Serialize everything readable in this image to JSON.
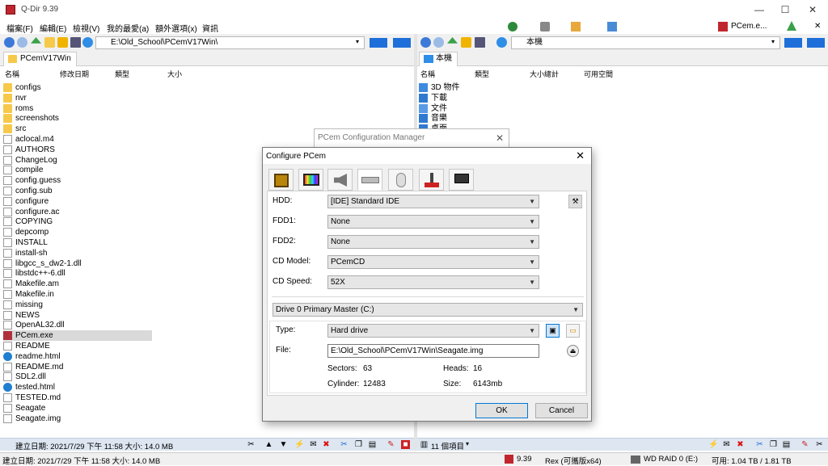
{
  "window": {
    "title": "Q-Dir 9.39",
    "minimize": "—",
    "maximize": "☐",
    "close": "✕"
  },
  "menu": [
    "檔案(F)",
    "編輯(E)",
    "檢視(V)",
    "我的最愛(a)",
    "額外選項(x)",
    "資訊"
  ],
  "menu_right_label": "PCem.e...",
  "left_pane": {
    "address": "E:\\Old_School\\PCemV17Win\\",
    "tab": "PCemV17Win",
    "columns": [
      "名稱",
      "修改日期",
      "類型",
      "大小"
    ],
    "files": [
      {
        "name": "configs",
        "kind": "folder"
      },
      {
        "name": "nvr",
        "kind": "folder"
      },
      {
        "name": "roms",
        "kind": "folder"
      },
      {
        "name": "screenshots",
        "kind": "folder"
      },
      {
        "name": "src",
        "kind": "folder"
      },
      {
        "name": "aclocal.m4",
        "kind": "file"
      },
      {
        "name": "AUTHORS",
        "kind": "file"
      },
      {
        "name": "ChangeLog",
        "kind": "file"
      },
      {
        "name": "compile",
        "kind": "file"
      },
      {
        "name": "config.guess",
        "kind": "file"
      },
      {
        "name": "config.sub",
        "kind": "file"
      },
      {
        "name": "configure",
        "kind": "file"
      },
      {
        "name": "configure.ac",
        "kind": "file"
      },
      {
        "name": "COPYING",
        "kind": "file"
      },
      {
        "name": "depcomp",
        "kind": "file"
      },
      {
        "name": "INSTALL",
        "kind": "file"
      },
      {
        "name": "install-sh",
        "kind": "file"
      },
      {
        "name": "libgcc_s_dw2-1.dll",
        "kind": "file"
      },
      {
        "name": "libstdc++-6.dll",
        "kind": "file"
      },
      {
        "name": "Makefile.am",
        "kind": "file"
      },
      {
        "name": "Makefile.in",
        "kind": "file"
      },
      {
        "name": "missing",
        "kind": "file"
      },
      {
        "name": "NEWS",
        "kind": "file"
      },
      {
        "name": "OpenAL32.dll",
        "kind": "file"
      },
      {
        "name": "PCem.exe",
        "kind": "exe",
        "selected": true
      },
      {
        "name": "README",
        "kind": "file"
      },
      {
        "name": "readme.html",
        "kind": "edge"
      },
      {
        "name": "README.md",
        "kind": "file"
      },
      {
        "name": "SDL2.dll",
        "kind": "file"
      },
      {
        "name": "tested.html",
        "kind": "edge"
      },
      {
        "name": "TESTED.md",
        "kind": "file"
      },
      {
        "name": "Seagate",
        "kind": "file"
      },
      {
        "name": "Seagate.img",
        "kind": "file"
      }
    ],
    "status": "建立日期: 2021/7/29 下午 11:58 大小: 14.0 MB"
  },
  "right_pane": {
    "address": "本機",
    "tab": "本機",
    "columns": [
      "名稱",
      "類型",
      "大小總計",
      "可用空間"
    ],
    "items": [
      "3D 物件",
      "下載",
      "文件",
      "音樂",
      "桌面"
    ],
    "status": "11 個項目"
  },
  "bottom_bar": {
    "info": "建立日期: 2021/7/29 下午 11:58 大小: 14.0 MB",
    "version": "9.39",
    "edition": "Rex (可攜版x64)",
    "drive": "WD RAID 0 (E:)",
    "space": "可用: 1.04 TB / 1.81 TB"
  },
  "manager_window": {
    "title": "PCem Configuration Manager"
  },
  "dialog": {
    "title": "Configure PCem",
    "close": "✕",
    "tabs": [
      "machine",
      "display",
      "sound",
      "storage",
      "mouse",
      "joystick",
      "network"
    ],
    "active_tab": 3,
    "fields": {
      "hdd": {
        "label": "HDD:",
        "value": "[IDE] Standard IDE"
      },
      "fdd1": {
        "label": "FDD1:",
        "value": "None"
      },
      "fdd2": {
        "label": "FDD2:",
        "value": "None"
      },
      "cd_model": {
        "label": "CD Model:",
        "value": "PCemCD"
      },
      "cd_speed": {
        "label": "CD Speed:",
        "value": "52X"
      }
    },
    "drive_select": "Drive 0 Primary Master (C:)",
    "type": {
      "label": "Type:",
      "value": "Hard drive"
    },
    "file": {
      "label": "File:",
      "value": "E:\\Old_School\\PCemV17Win\\Seagate.img"
    },
    "geometry": {
      "sectors_label": "Sectors:",
      "sectors": "63",
      "heads_label": "Heads:",
      "heads": "16",
      "cylinder_label": "Cylinder:",
      "cylinder": "12483",
      "size_label": "Size:",
      "size": "6143mb"
    },
    "ok": "OK",
    "cancel": "Cancel"
  },
  "colors": {
    "accent": "#0078d7",
    "statusbar": "#dde6f1",
    "selection": "#d9d9d9",
    "folder": "#f6c94b"
  }
}
